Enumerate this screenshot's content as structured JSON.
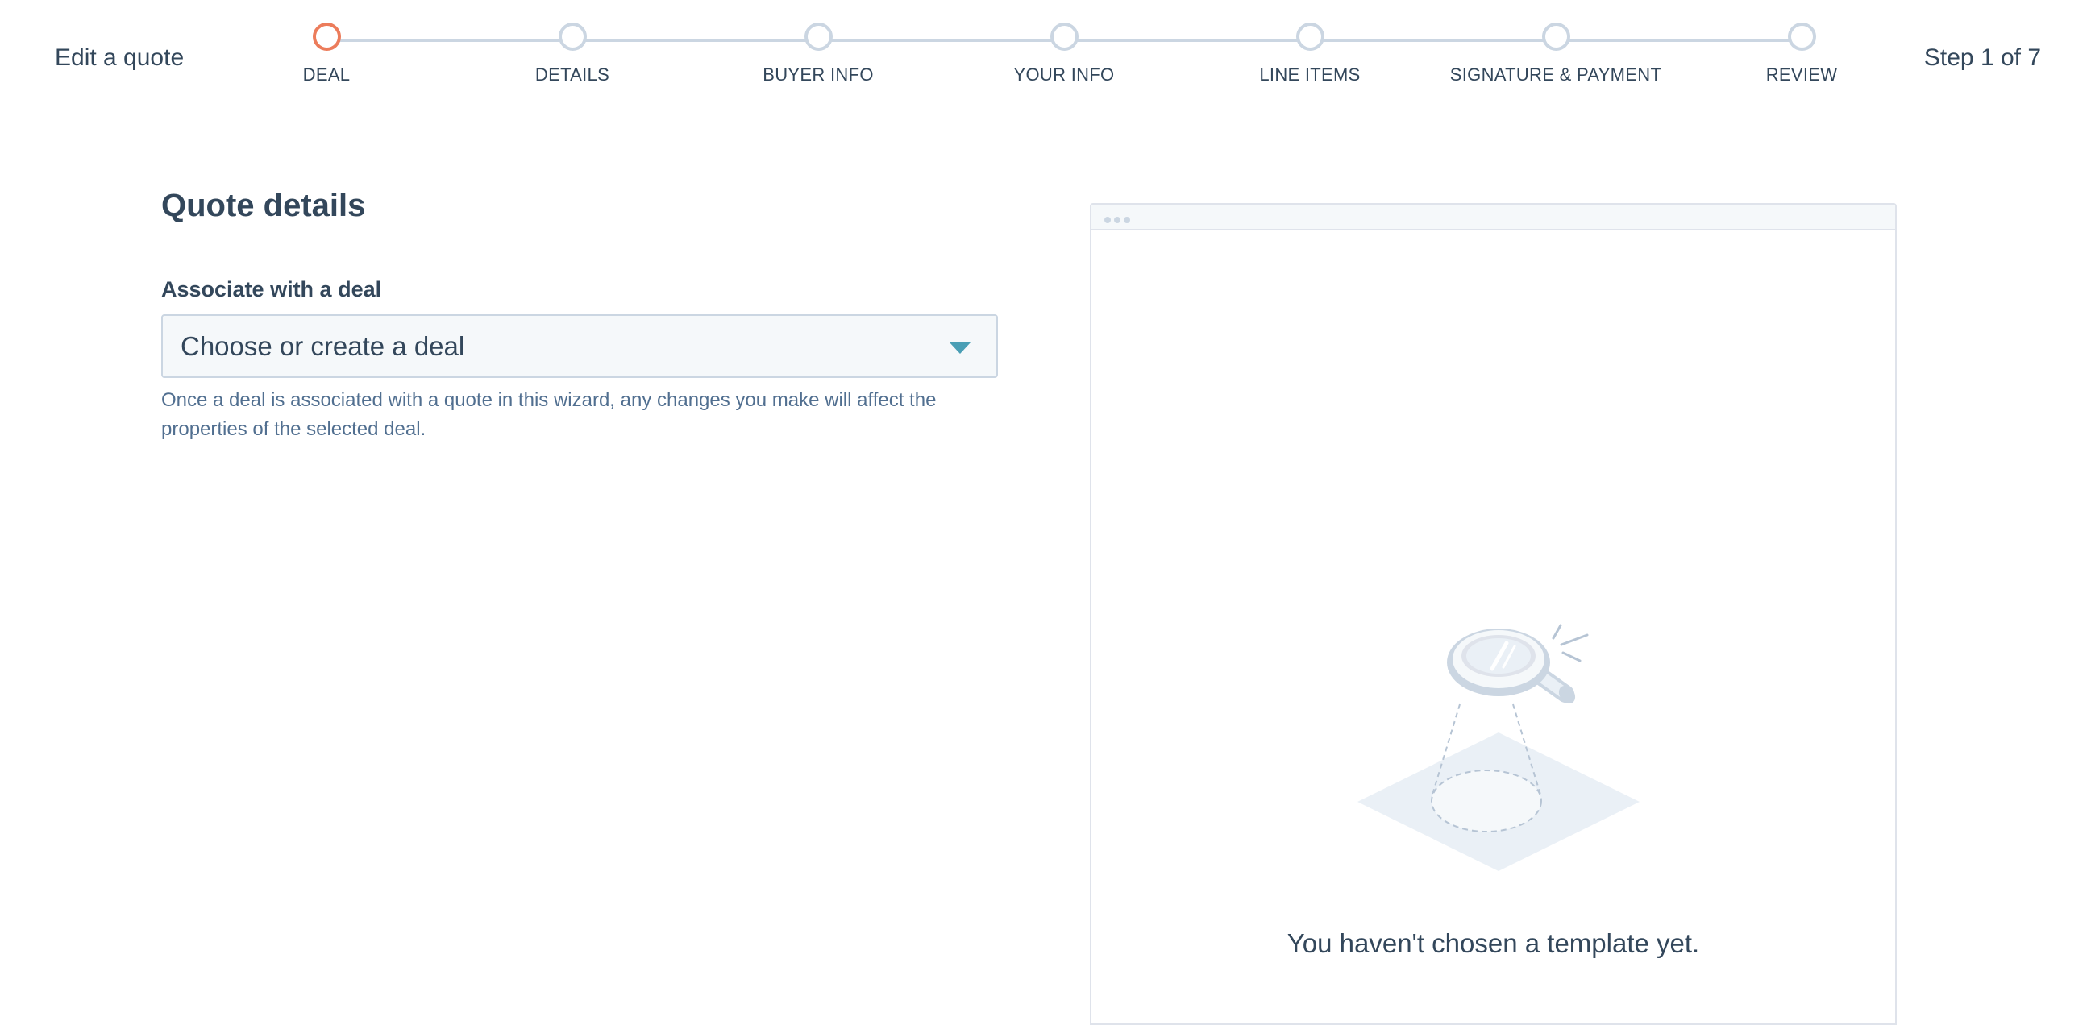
{
  "header": {
    "title": "Edit a quote",
    "step_counter": "Step 1 of 7"
  },
  "steps": [
    {
      "label": "DEAL",
      "state": "active"
    },
    {
      "label": "DETAILS",
      "state": "upcoming"
    },
    {
      "label": "BUYER INFO",
      "state": "upcoming"
    },
    {
      "label": "YOUR INFO",
      "state": "upcoming"
    },
    {
      "label": "LINE ITEMS",
      "state": "upcoming"
    },
    {
      "label": "SIGNATURE & PAYMENT",
      "state": "upcoming"
    },
    {
      "label": "REVIEW",
      "state": "upcoming"
    }
  ],
  "form": {
    "section_title": "Quote details",
    "deal_field": {
      "label": "Associate with a deal",
      "placeholder": "Choose or create a deal",
      "help_text": "Once a deal is associated with a quote in this wizard, any changes you make will affect the properties of the selected deal."
    }
  },
  "preview": {
    "empty_message": "You haven't chosen a template yet.",
    "illustration_icon": "magnifying-glass-icon"
  },
  "colors": {
    "text_primary": "#33475b",
    "text_secondary": "#516f90",
    "active_step": "#ec7c5b",
    "inactive_step": "#cbd6e2",
    "dropdown_caret": "#4a9fb5",
    "input_background": "#f5f8fa"
  }
}
